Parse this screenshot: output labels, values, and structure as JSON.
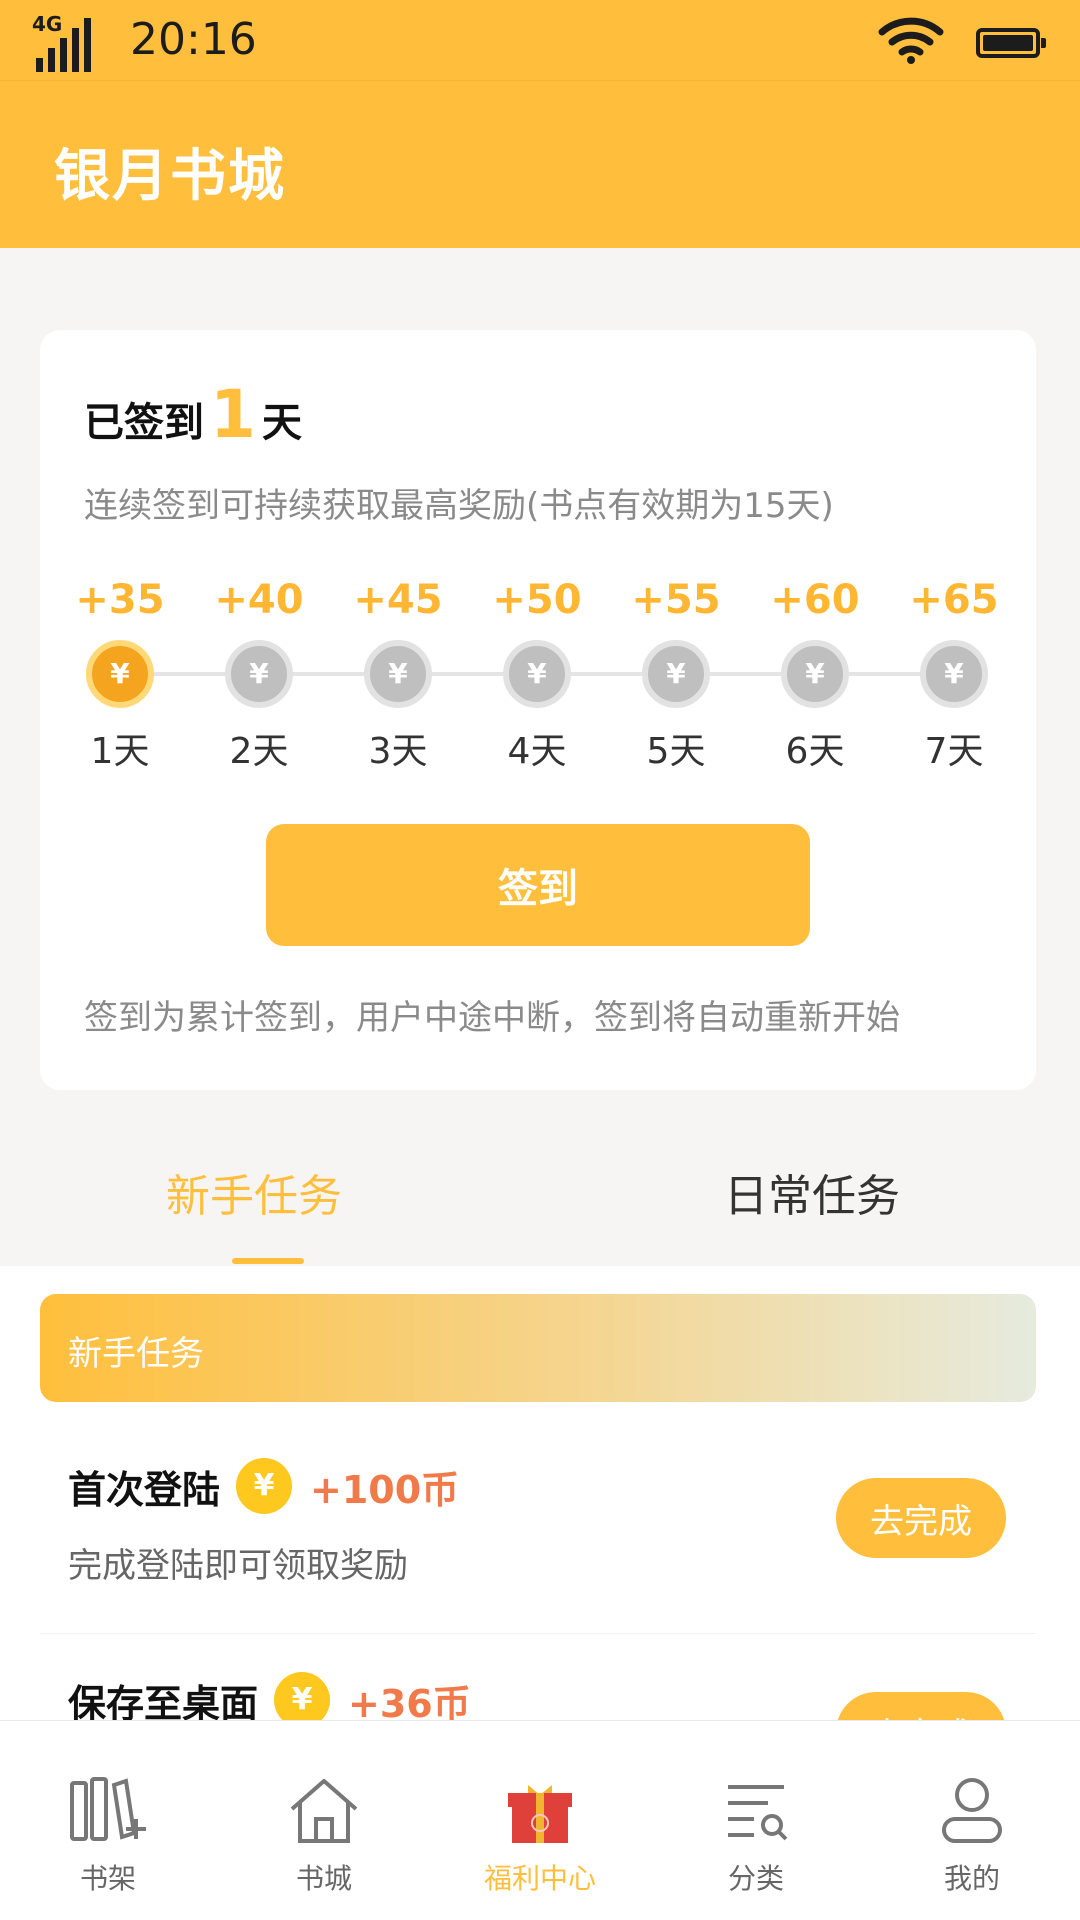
{
  "status_bar": {
    "network": "4G",
    "time": "20:16"
  },
  "app": {
    "title": "银月书城"
  },
  "sign_in": {
    "prefix": "已签到",
    "days": "1",
    "suffix": "天",
    "hint": "连续签到可持续获取最高奖励(书点有效期为15天)",
    "rewards": [
      {
        "points": "+35",
        "label": "1天",
        "done": true
      },
      {
        "points": "+40",
        "label": "2天",
        "done": false
      },
      {
        "points": "+45",
        "label": "3天",
        "done": false
      },
      {
        "points": "+50",
        "label": "4天",
        "done": false
      },
      {
        "points": "+55",
        "label": "5天",
        "done": false
      },
      {
        "points": "+60",
        "label": "6天",
        "done": false
      },
      {
        "points": "+65",
        "label": "7天",
        "done": false
      }
    ],
    "coin_symbol": "¥",
    "button": "签到",
    "rule": "签到为累计签到，用户中途中断，签到将自动重新开始"
  },
  "tabs": [
    {
      "label": "新手任务",
      "active": true
    },
    {
      "label": "日常任务",
      "active": false
    }
  ],
  "task_section": {
    "banner": "新手任务",
    "tasks": [
      {
        "name": "首次登陆",
        "coin_symbol": "¥",
        "reward": "+100币",
        "desc": "完成登陆即可领取奖励",
        "action": "去完成"
      },
      {
        "name": "保存至桌面",
        "coin_symbol": "¥",
        "reward": "+36币",
        "desc": "",
        "action": "去完成"
      }
    ]
  },
  "bottom_nav": [
    {
      "label": "书架",
      "icon": "bookshelf-icon",
      "active": false
    },
    {
      "label": "书城",
      "icon": "house-icon",
      "active": false
    },
    {
      "label": "福利中心",
      "icon": "gift-box-icon",
      "active": true
    },
    {
      "label": "分类",
      "icon": "category-search-icon",
      "active": false
    },
    {
      "label": "我的",
      "icon": "user-icon",
      "active": false
    }
  ],
  "colors": {
    "brand": "#ffbf3c",
    "reward_text": "#f07a4a",
    "coin_done": "#f4a41f",
    "coin_pending": "#bfbfbf",
    "gift_red": "#e0403a"
  }
}
